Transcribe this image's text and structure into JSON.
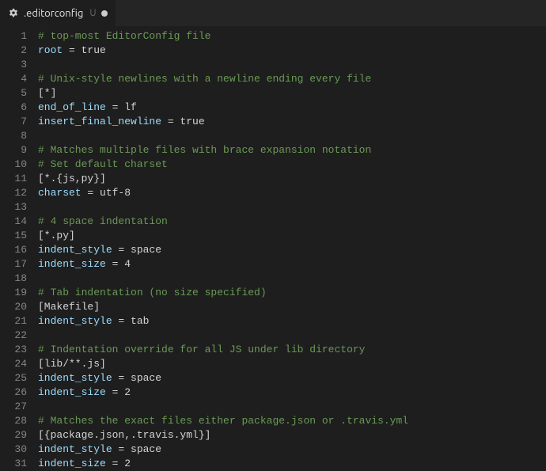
{
  "tab": {
    "filename": ".editorconfig",
    "git_status": "U",
    "modified": true,
    "icon_name": "gear-icon"
  },
  "lines": [
    {
      "n": 1,
      "tokens": [
        {
          "t": "# top-most EditorConfig file",
          "c": "comment"
        }
      ]
    },
    {
      "n": 2,
      "tokens": [
        {
          "t": "root",
          "c": "key"
        },
        {
          "t": " = ",
          "c": "op"
        },
        {
          "t": "true",
          "c": "value"
        }
      ]
    },
    {
      "n": 3,
      "tokens": []
    },
    {
      "n": 4,
      "tokens": [
        {
          "t": "# Unix-style newlines with a newline ending every file",
          "c": "comment"
        }
      ]
    },
    {
      "n": 5,
      "tokens": [
        {
          "t": "[*]",
          "c": "section"
        }
      ]
    },
    {
      "n": 6,
      "tokens": [
        {
          "t": "end_of_line",
          "c": "key"
        },
        {
          "t": " = ",
          "c": "op"
        },
        {
          "t": "lf",
          "c": "value"
        }
      ]
    },
    {
      "n": 7,
      "tokens": [
        {
          "t": "insert_final_newline",
          "c": "key"
        },
        {
          "t": " = ",
          "c": "op"
        },
        {
          "t": "true",
          "c": "value"
        }
      ]
    },
    {
      "n": 8,
      "tokens": []
    },
    {
      "n": 9,
      "tokens": [
        {
          "t": "# Matches multiple files with brace expansion notation",
          "c": "comment"
        }
      ]
    },
    {
      "n": 10,
      "tokens": [
        {
          "t": "# Set default charset",
          "c": "comment"
        }
      ]
    },
    {
      "n": 11,
      "tokens": [
        {
          "t": "[*.{js,py}]",
          "c": "section"
        }
      ]
    },
    {
      "n": 12,
      "tokens": [
        {
          "t": "charset",
          "c": "key"
        },
        {
          "t": " = ",
          "c": "op"
        },
        {
          "t": "utf-8",
          "c": "value"
        }
      ]
    },
    {
      "n": 13,
      "tokens": []
    },
    {
      "n": 14,
      "tokens": [
        {
          "t": "# 4 space indentation",
          "c": "comment"
        }
      ]
    },
    {
      "n": 15,
      "tokens": [
        {
          "t": "[*.py]",
          "c": "section"
        }
      ]
    },
    {
      "n": 16,
      "tokens": [
        {
          "t": "indent_style",
          "c": "key"
        },
        {
          "t": " = ",
          "c": "op"
        },
        {
          "t": "space",
          "c": "value"
        }
      ]
    },
    {
      "n": 17,
      "tokens": [
        {
          "t": "indent_size",
          "c": "key"
        },
        {
          "t": " = ",
          "c": "op"
        },
        {
          "t": "4",
          "c": "value"
        }
      ]
    },
    {
      "n": 18,
      "tokens": []
    },
    {
      "n": 19,
      "tokens": [
        {
          "t": "# Tab indentation (no size specified)",
          "c": "comment"
        }
      ]
    },
    {
      "n": 20,
      "tokens": [
        {
          "t": "[Makefile]",
          "c": "section"
        }
      ]
    },
    {
      "n": 21,
      "tokens": [
        {
          "t": "indent_style",
          "c": "key"
        },
        {
          "t": " = ",
          "c": "op"
        },
        {
          "t": "tab",
          "c": "value"
        }
      ]
    },
    {
      "n": 22,
      "tokens": []
    },
    {
      "n": 23,
      "tokens": [
        {
          "t": "# Indentation override for all JS under lib directory",
          "c": "comment"
        }
      ]
    },
    {
      "n": 24,
      "tokens": [
        {
          "t": "[lib/**.js]",
          "c": "section"
        }
      ]
    },
    {
      "n": 25,
      "tokens": [
        {
          "t": "indent_style",
          "c": "key"
        },
        {
          "t": " = ",
          "c": "op"
        },
        {
          "t": "space",
          "c": "value"
        }
      ]
    },
    {
      "n": 26,
      "tokens": [
        {
          "t": "indent_size",
          "c": "key"
        },
        {
          "t": " = ",
          "c": "op"
        },
        {
          "t": "2",
          "c": "value"
        }
      ]
    },
    {
      "n": 27,
      "tokens": []
    },
    {
      "n": 28,
      "tokens": [
        {
          "t": "# Matches the exact files either package.json or .travis.yml",
          "c": "comment"
        }
      ]
    },
    {
      "n": 29,
      "tokens": [
        {
          "t": "[{package.json,.travis.yml}]",
          "c": "section"
        }
      ]
    },
    {
      "n": 30,
      "tokens": [
        {
          "t": "indent_style",
          "c": "key"
        },
        {
          "t": " = ",
          "c": "op"
        },
        {
          "t": "space",
          "c": "value"
        }
      ]
    },
    {
      "n": 31,
      "tokens": [
        {
          "t": "indent_size",
          "c": "key"
        },
        {
          "t": " = ",
          "c": "op"
        },
        {
          "t": "2",
          "c": "value"
        }
      ]
    }
  ]
}
